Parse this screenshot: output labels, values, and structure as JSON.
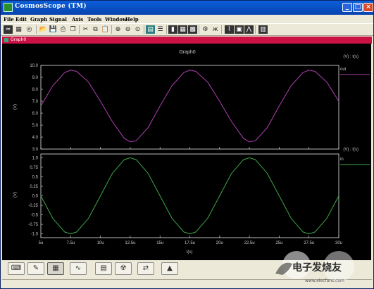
{
  "window": {
    "title": "CosmosScope (TM)"
  },
  "menu": [
    "File",
    "Edit",
    "Graph",
    "Signal",
    "Axis",
    "Tools",
    "Window",
    "Help"
  ],
  "subwindow": {
    "title": "Graph0"
  },
  "chart_data": [
    {
      "type": "line",
      "title": "Graph0",
      "xlabel": "t(s)",
      "ylabel": "(V)",
      "legend_header": "(V) : t(s)",
      "xlim": [
        5,
        30
      ],
      "ylim": [
        3.0,
        10.0
      ],
      "xticks": [
        "5u",
        "7.5u",
        "10u",
        "12.5u",
        "15u",
        "17.5u",
        "20u",
        "22.5u",
        "25u",
        "27.5u",
        "30u"
      ],
      "yticks": [
        "10.0",
        "9.0",
        "8.0",
        "7.0",
        "6.0",
        "5.0",
        "4.0",
        "3.0"
      ],
      "series": [
        {
          "name": "out",
          "color": "#b040b0",
          "x_unit": "us",
          "x": [
            5,
            6,
            7,
            7.5,
            8,
            9,
            10,
            11,
            12,
            12.5,
            13,
            14,
            15,
            16,
            17,
            17.5,
            18,
            19,
            20,
            21,
            22,
            22.5,
            23,
            24,
            25,
            26,
            27,
            27.5,
            28,
            29,
            30
          ],
          "y": [
            6.6,
            8.3,
            9.4,
            9.6,
            9.5,
            8.6,
            7.0,
            5.3,
            3.9,
            3.6,
            3.7,
            4.8,
            6.6,
            8.3,
            9.4,
            9.6,
            9.5,
            8.6,
            7.0,
            5.3,
            3.9,
            3.6,
            3.7,
            4.8,
            6.6,
            8.3,
            9.4,
            9.6,
            9.5,
            8.6,
            7.0
          ]
        }
      ]
    },
    {
      "type": "line",
      "xlabel": "t(s)",
      "ylabel": "(V)",
      "legend_header": "(V) : t(s)",
      "xlim": [
        5,
        30
      ],
      "ylim": [
        -1.1,
        1.1
      ],
      "xticks": [
        "5u",
        "7.5u",
        "10u",
        "12.5u",
        "15u",
        "17.5u",
        "20u",
        "22.5u",
        "25u",
        "27.5u",
        "30u"
      ],
      "yticks": [
        "1.0",
        "0.75",
        "0.5",
        "0.25",
        "0.0",
        "-0.25",
        "-0.5",
        "-0.75",
        "-1.0"
      ],
      "series": [
        {
          "name": "in",
          "color": "#3fa84a",
          "x_unit": "us",
          "x": [
            5,
            6,
            7,
            7.5,
            8,
            9,
            10,
            11,
            12,
            12.5,
            13,
            14,
            15,
            16,
            17,
            17.5,
            18,
            19,
            20,
            21,
            22,
            22.5,
            23,
            24,
            25,
            26,
            27,
            27.5,
            28,
            29,
            30
          ],
          "y": [
            0.0,
            -0.59,
            -0.95,
            -1.0,
            -0.95,
            -0.59,
            0.0,
            0.59,
            0.95,
            1.0,
            0.95,
            0.59,
            0.0,
            -0.59,
            -0.95,
            -1.0,
            -0.95,
            -0.59,
            0.0,
            0.59,
            0.95,
            1.0,
            0.95,
            0.59,
            0.0,
            -0.59,
            -0.95,
            -1.0,
            -0.95,
            -0.59,
            0.0
          ]
        }
      ]
    }
  ],
  "watermark": {
    "text": "电子发烧友",
    "sub": "www.elecfans.com"
  },
  "icons": {
    "toolbar": [
      "waveform-icon",
      "grid-icon",
      "target-icon",
      "sep",
      "open-folder-icon",
      "save-icon",
      "print-icon",
      "copy-icon",
      "sep",
      "cut-icon",
      "copy2-icon",
      "paste-icon",
      "sep",
      "zoom-in-icon",
      "zoom-out-icon",
      "zoom-fit-icon",
      "sep",
      "stack-icon",
      "list-icon",
      "sep",
      "marker-icon",
      "table-icon",
      "grid2-icon",
      "sep",
      "scope-icon",
      "butterfly-icon",
      "sep",
      "chart-icon",
      "photo-icon",
      "signal-icon",
      "sep",
      "spectrum-icon"
    ],
    "bottom": [
      "keyboard-icon",
      "pen-icon",
      "graph-tool-icon",
      "curve-icon",
      "calculator-icon",
      "nuclear-icon",
      "transfer-icon",
      "matlab-icon"
    ]
  }
}
